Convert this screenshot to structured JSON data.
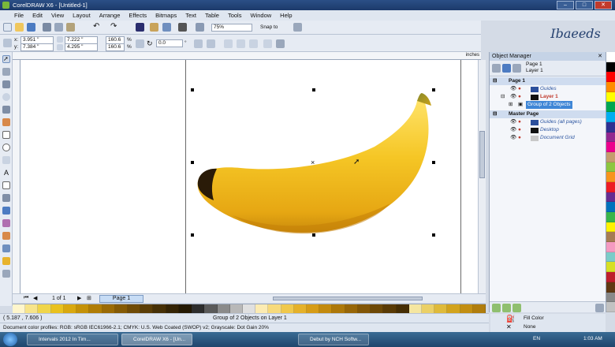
{
  "window": {
    "title": "CorelDRAW X6 - [Untitled-1]"
  },
  "menu": [
    "File",
    "Edit",
    "View",
    "Layout",
    "Arrange",
    "Effects",
    "Bitmaps",
    "Text",
    "Table",
    "Tools",
    "Window",
    "Help"
  ],
  "toolbar": {
    "zoom": "75%",
    "snap_to": "Snap to",
    "logo": "Ibaeeds"
  },
  "property_bar": {
    "x_label": "x:",
    "x": "3.951 \"",
    "y_label": "y:",
    "y": "7.384 \"",
    "width": "7.222 \"",
    "height": "4.295 \"",
    "scale_x": "160.6",
    "scale_y": "160.6",
    "percent": "%",
    "angle": "0.0",
    "angle_unit": "°"
  },
  "rulers": {
    "units": "inches"
  },
  "page_nav": {
    "position": "1 of 1",
    "tab": "Page 1"
  },
  "status": {
    "coordinates": "( 5.187 , 7.606 )",
    "selection": "Group of 2 Objects on Layer 1",
    "profiles": "Document color profiles: RGB: sRGB IEC61966-2.1; CMYK: U.S. Web Coated (SWOP) v2; Grayscale: Dot Gain 20%",
    "fill_label": "Fill Color",
    "outline_label": "None"
  },
  "object_manager": {
    "title": "Object Manager",
    "header_page": "Page 1",
    "header_layer": "Layer 1",
    "rows": [
      {
        "label": "Page 1",
        "type": "page"
      },
      {
        "label": "Guides",
        "type": "sub"
      },
      {
        "label": "Layer 1",
        "type": "layer"
      },
      {
        "label": "Group of 2 Objects",
        "type": "object"
      },
      {
        "label": "Master Page",
        "type": "page"
      },
      {
        "label": "Guides (all pages)",
        "type": "sub"
      },
      {
        "label": "Desktop",
        "type": "sub"
      },
      {
        "label": "Document Grid",
        "type": "sub"
      }
    ]
  },
  "taskbar": {
    "tasks": [
      "Intervals 2012 In Tim...",
      "CorelDRAW X6 - [Un...",
      "Debut by NCH Softw..."
    ],
    "lang": "EN",
    "time": "1:03 AM"
  },
  "colors": {
    "accent": "#2b4f86",
    "banana_yellow": "#f2c31a",
    "selection_highlight": "#3f86d6"
  },
  "bottom_palette": [
    "#fff6cc",
    "#f7e48a",
    "#f0d54a",
    "#e9c11e",
    "#d9a80f",
    "#c49108",
    "#b07c05",
    "#9a6a05",
    "#845a05",
    "#6f4b06",
    "#5a3d06",
    "#463006",
    "#342405",
    "#241903",
    "#2d2d2d",
    "#5a5a5a",
    "#8a8a8a",
    "#b8b8b8",
    "#e0e0e0",
    "#fcebb2",
    "#f7da7c",
    "#f0c84b",
    "#e5b12a",
    "#d69c17",
    "#c38a0e",
    "#ad780a",
    "#976608",
    "#825607",
    "#6d4806",
    "#593a05",
    "#462e04",
    "#f5e6a0",
    "#ebd066",
    "#dfba3a",
    "#d2a31d",
    "#c28e12",
    "#b07d0d"
  ],
  "right_palette": [
    "#ffffff",
    "#000000",
    "#ff0000",
    "#ff8c00",
    "#ffff00",
    "#00a651",
    "#00aeef",
    "#2e3192",
    "#92278f",
    "#ec008c",
    "#c69c6d",
    "#8dc63f",
    "#f7941d",
    "#ed1c24",
    "#662d91",
    "#0072bc",
    "#39b54a",
    "#fff200",
    "#a67c52",
    "#f49ac1",
    "#7accc8",
    "#d7df23",
    "#be1e2d",
    "#603913",
    "#898989",
    "#c2c2c2"
  ]
}
